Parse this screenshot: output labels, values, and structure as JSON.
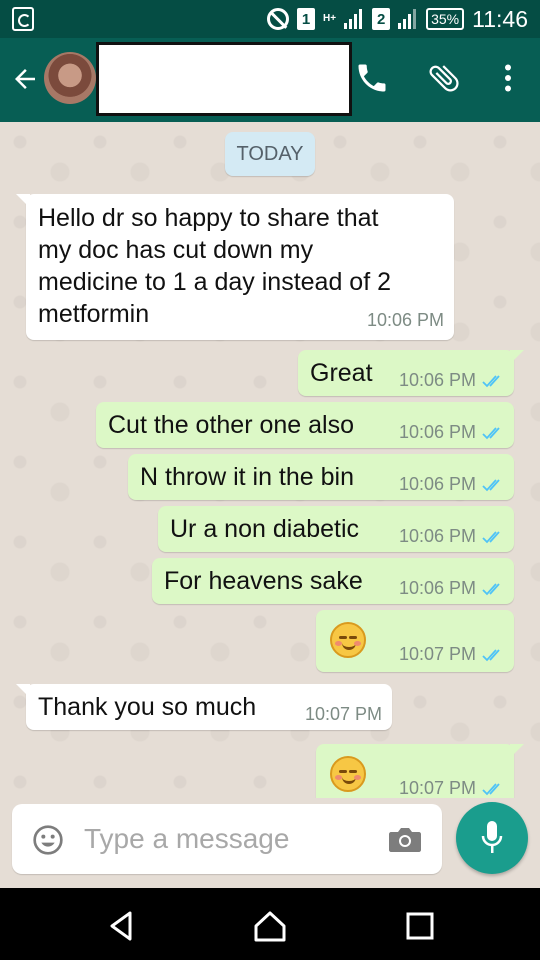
{
  "status_bar": {
    "sim1": "1",
    "net1": "H+",
    "sim2": "2",
    "battery": "35%",
    "time": "11:46"
  },
  "header": {
    "icons": [
      "back-arrow-icon",
      "phone-icon",
      "attachment-icon",
      "more-vert-icon"
    ]
  },
  "chat": {
    "date_chip": "TODAY",
    "messages": [
      {
        "direction": "in",
        "lines": [
          "Hello dr so happy to share that",
          "my doc has cut down my",
          "medicine to 1 a day instead of 2",
          "metformin"
        ],
        "time": "10:06 PM"
      },
      {
        "direction": "out",
        "text": "Great",
        "time": "10:06 PM"
      },
      {
        "direction": "out",
        "text": "Cut the other one also",
        "time": "10:06 PM"
      },
      {
        "direction": "out",
        "text": "N throw it in the bin",
        "time": "10:06 PM"
      },
      {
        "direction": "out",
        "text": "Ur a non diabetic",
        "time": "10:06 PM"
      },
      {
        "direction": "out",
        "text": "For heavens sake",
        "time": "10:06 PM"
      },
      {
        "direction": "out",
        "emoji": "smiling-blush",
        "time": "10:07 PM"
      },
      {
        "direction": "in",
        "text": "Thank you so much",
        "time": "10:07 PM"
      },
      {
        "direction": "out",
        "emoji": "smiling-blush",
        "time": "10:07 PM"
      }
    ]
  },
  "composer": {
    "placeholder": "Type a message"
  },
  "colors": {
    "header": "#075e54",
    "status_bar": "#054d44",
    "outgoing_bubble": "#dcf8c6",
    "incoming_bubble": "#ffffff",
    "mic_button": "#1a9d8d",
    "read_ticks": "#4fc3f7"
  }
}
